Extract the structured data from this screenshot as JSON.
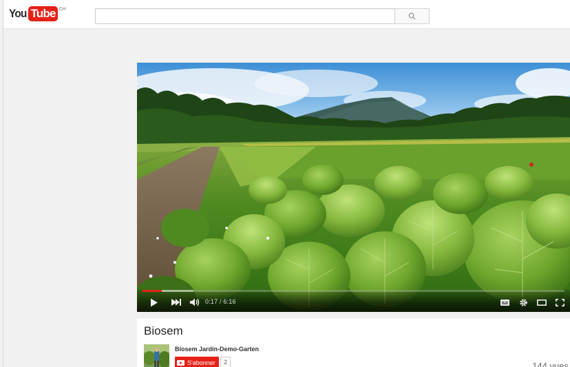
{
  "header": {
    "logo_you": "You",
    "logo_tube": "Tube",
    "logo_country": "CH",
    "search_placeholder": ""
  },
  "player": {
    "time_display": "0:17 / 6:16",
    "progress_fraction": 0.045,
    "buffer_fraction": 0.12,
    "accent_color": "#e62117"
  },
  "video": {
    "title": "Biosem",
    "channel_name": "Biosem Jardin-Demo-Garten",
    "subscribe_label": "S'abonner",
    "subscriber_count": "2",
    "views": "144 vues"
  },
  "icons": {
    "search": "search-icon",
    "play": "play-icon",
    "next": "next-icon",
    "volume": "volume-icon",
    "captions": "captions-icon",
    "settings": "gear-icon",
    "theater": "theater-mode-icon",
    "fullscreen": "fullscreen-icon"
  }
}
